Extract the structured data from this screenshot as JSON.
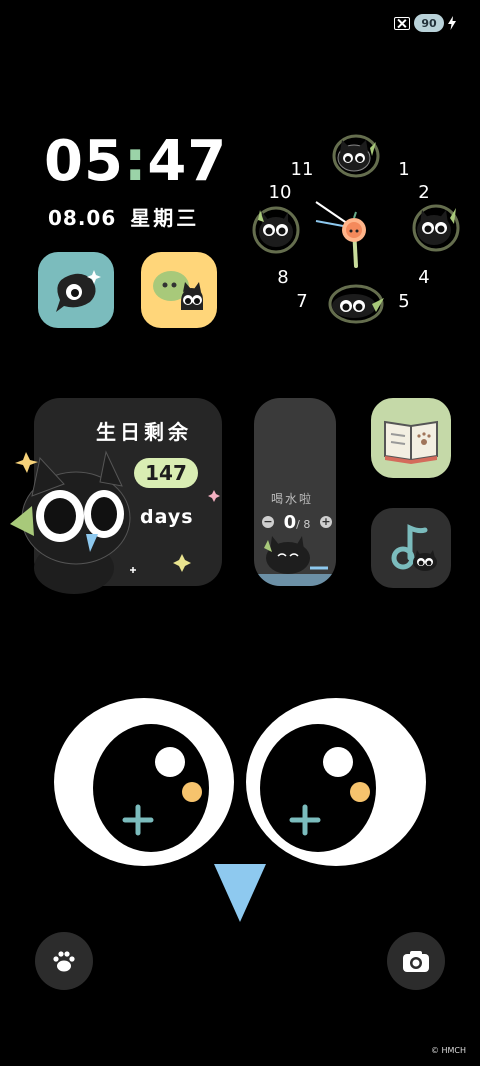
{
  "status_bar": {
    "battery_level": "90",
    "icons": [
      "sim-off-icon",
      "battery-icon",
      "charging-icon"
    ]
  },
  "clock": {
    "hours": "05",
    "minutes": "47",
    "date": "08.06",
    "weekday": "星期三"
  },
  "analog_clock": {
    "numerals": [
      "11",
      "1",
      "10",
      "2",
      "8",
      "4",
      "7",
      "5"
    ]
  },
  "widgets": {
    "birthday": {
      "title": "生日剩余",
      "count": "147",
      "unit": "days"
    },
    "water": {
      "title": "喝水啦",
      "count": "0",
      "total": "/ 8",
      "minus": "−",
      "plus": "+"
    }
  },
  "apps": [
    {
      "name": "app-cat-bubble",
      "icon": "cat-bubble-icon",
      "color": "#7bbcbd"
    },
    {
      "name": "app-chat-cat",
      "icon": "chat-cat-icon",
      "color": "#ffd67a"
    },
    {
      "name": "app-book",
      "icon": "book-paw-icon",
      "color": "#c5d9a8"
    },
    {
      "name": "app-music",
      "icon": "music-note-icon",
      "color": "#303030"
    }
  ],
  "dock": {
    "left": "paw-icon",
    "right": "camera-icon"
  },
  "footer": {
    "copyright": "© HMCH"
  },
  "colors": {
    "accent_blue": "#8ec9ef",
    "accent_green": "#9bd3a8",
    "accent_yellow": "#ffd67a"
  }
}
